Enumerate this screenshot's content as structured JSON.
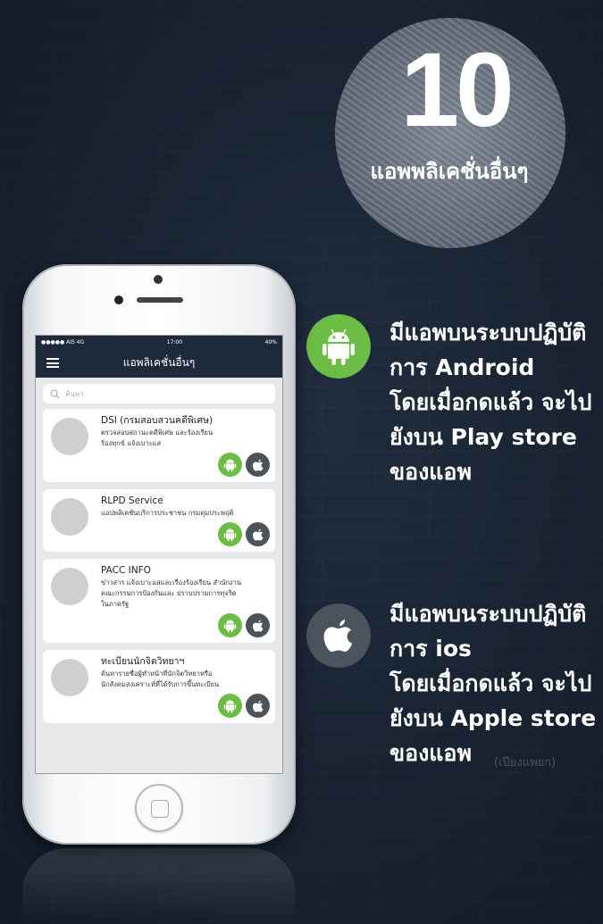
{
  "badge": {
    "number": "10",
    "subtitle": "แอพพลิเคชั่นอื่นๆ"
  },
  "features": {
    "android": {
      "icon": "android-icon",
      "lines": [
        "มีแอพบนระบบปฏิบัติ",
        "การ Android",
        "โดยเมื่อกดแล้ว จะไป",
        "ยังบน Play store",
        "ของแอพ"
      ]
    },
    "ios": {
      "icon": "apple-icon",
      "lines": [
        "มีแอพบนระบบปฏิบัติ",
        "การ ios",
        "โดยเมื่อกดแล้ว จะไป",
        "ยังบน Apple store",
        "ของแอพ"
      ]
    }
  },
  "watermark": "(เปียงแพยก)",
  "phone": {
    "status": {
      "carrier": "●●●●● AIS  4G",
      "time": "17:00",
      "battery": "40%"
    },
    "appbar": {
      "title": "แอพลิเคชั่นอื่นๆ"
    },
    "search": {
      "placeholder": "ค้นหา"
    },
    "apps": [
      {
        "title": "DSI (กรมสอบสวนคดีพิเศษ)",
        "desc": [
          "ตรวจสอบสถานะคดีพิเศษ และร้องเรียน",
          "ร้องทุกข์ แจ้งเบาะแส"
        ]
      },
      {
        "title": "RLPD Service",
        "desc": [
          "แอปพลิเคชั่นบริการประชาชน กรมคุมประพฤติ"
        ]
      },
      {
        "title": "PACC INFO",
        "desc": [
          "ข่าวสาร แจ้งเบาะแสและเรื่องร้องเรียน สำนักงาน",
          "คณะกรรมการป้องกันและ ปราบปรามการทุจริต",
          "ในภาครัฐ"
        ]
      },
      {
        "title": "ทะเบียนนักจิตวิทยาฯ",
        "desc": [
          "ค้นหารายชื่อผู้ทำหน้าที่นักจิตวิทยาหรือ",
          "นักสังคมสงเคราะห์ที่ได้รับการขึ้นทะเบียน"
        ]
      }
    ]
  },
  "colors": {
    "background": "#1c2737",
    "android": "#6cbd45",
    "apple": "#4b535c",
    "appbar": "#1e2a3c"
  }
}
